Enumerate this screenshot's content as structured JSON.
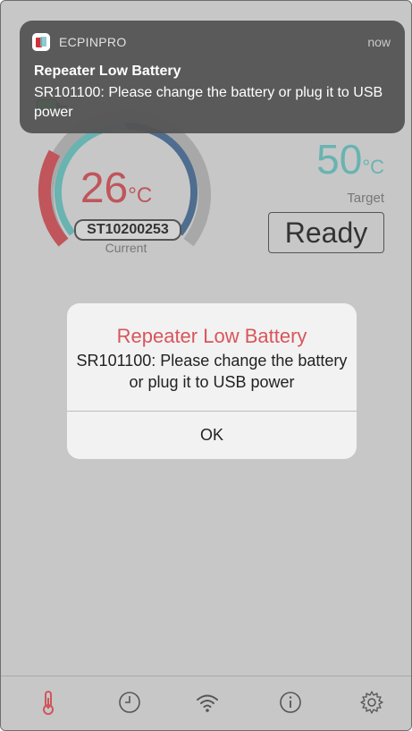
{
  "banner": {
    "app_name": "ECPINPRO",
    "time": "now",
    "title": "Repeater Low Battery",
    "body": "SR101100: Please change the battery or plug it to USB power"
  },
  "gauge": {
    "current_value": "26",
    "unit": "°C",
    "sensor_id": "ST10200253",
    "current_label": "Current"
  },
  "target": {
    "value": "50",
    "unit": "°C",
    "label": "Target",
    "status": "Ready"
  },
  "alert": {
    "title": "Repeater Low Battery",
    "message": "SR101100: Please change the battery or plug it to USB power",
    "ok_label": "OK"
  },
  "tabs": [
    {
      "icon": "thermometer-icon",
      "active": true
    },
    {
      "icon": "clock-icon"
    },
    {
      "icon": "wifi-icon"
    },
    {
      "icon": "info-icon"
    },
    {
      "icon": "gear-icon"
    }
  ],
  "colors": {
    "accent_red": "#d9555a",
    "accent_teal": "#69b3b1",
    "gauge_blue": "#4f6d8f",
    "battery_green": "#2ecc40"
  }
}
